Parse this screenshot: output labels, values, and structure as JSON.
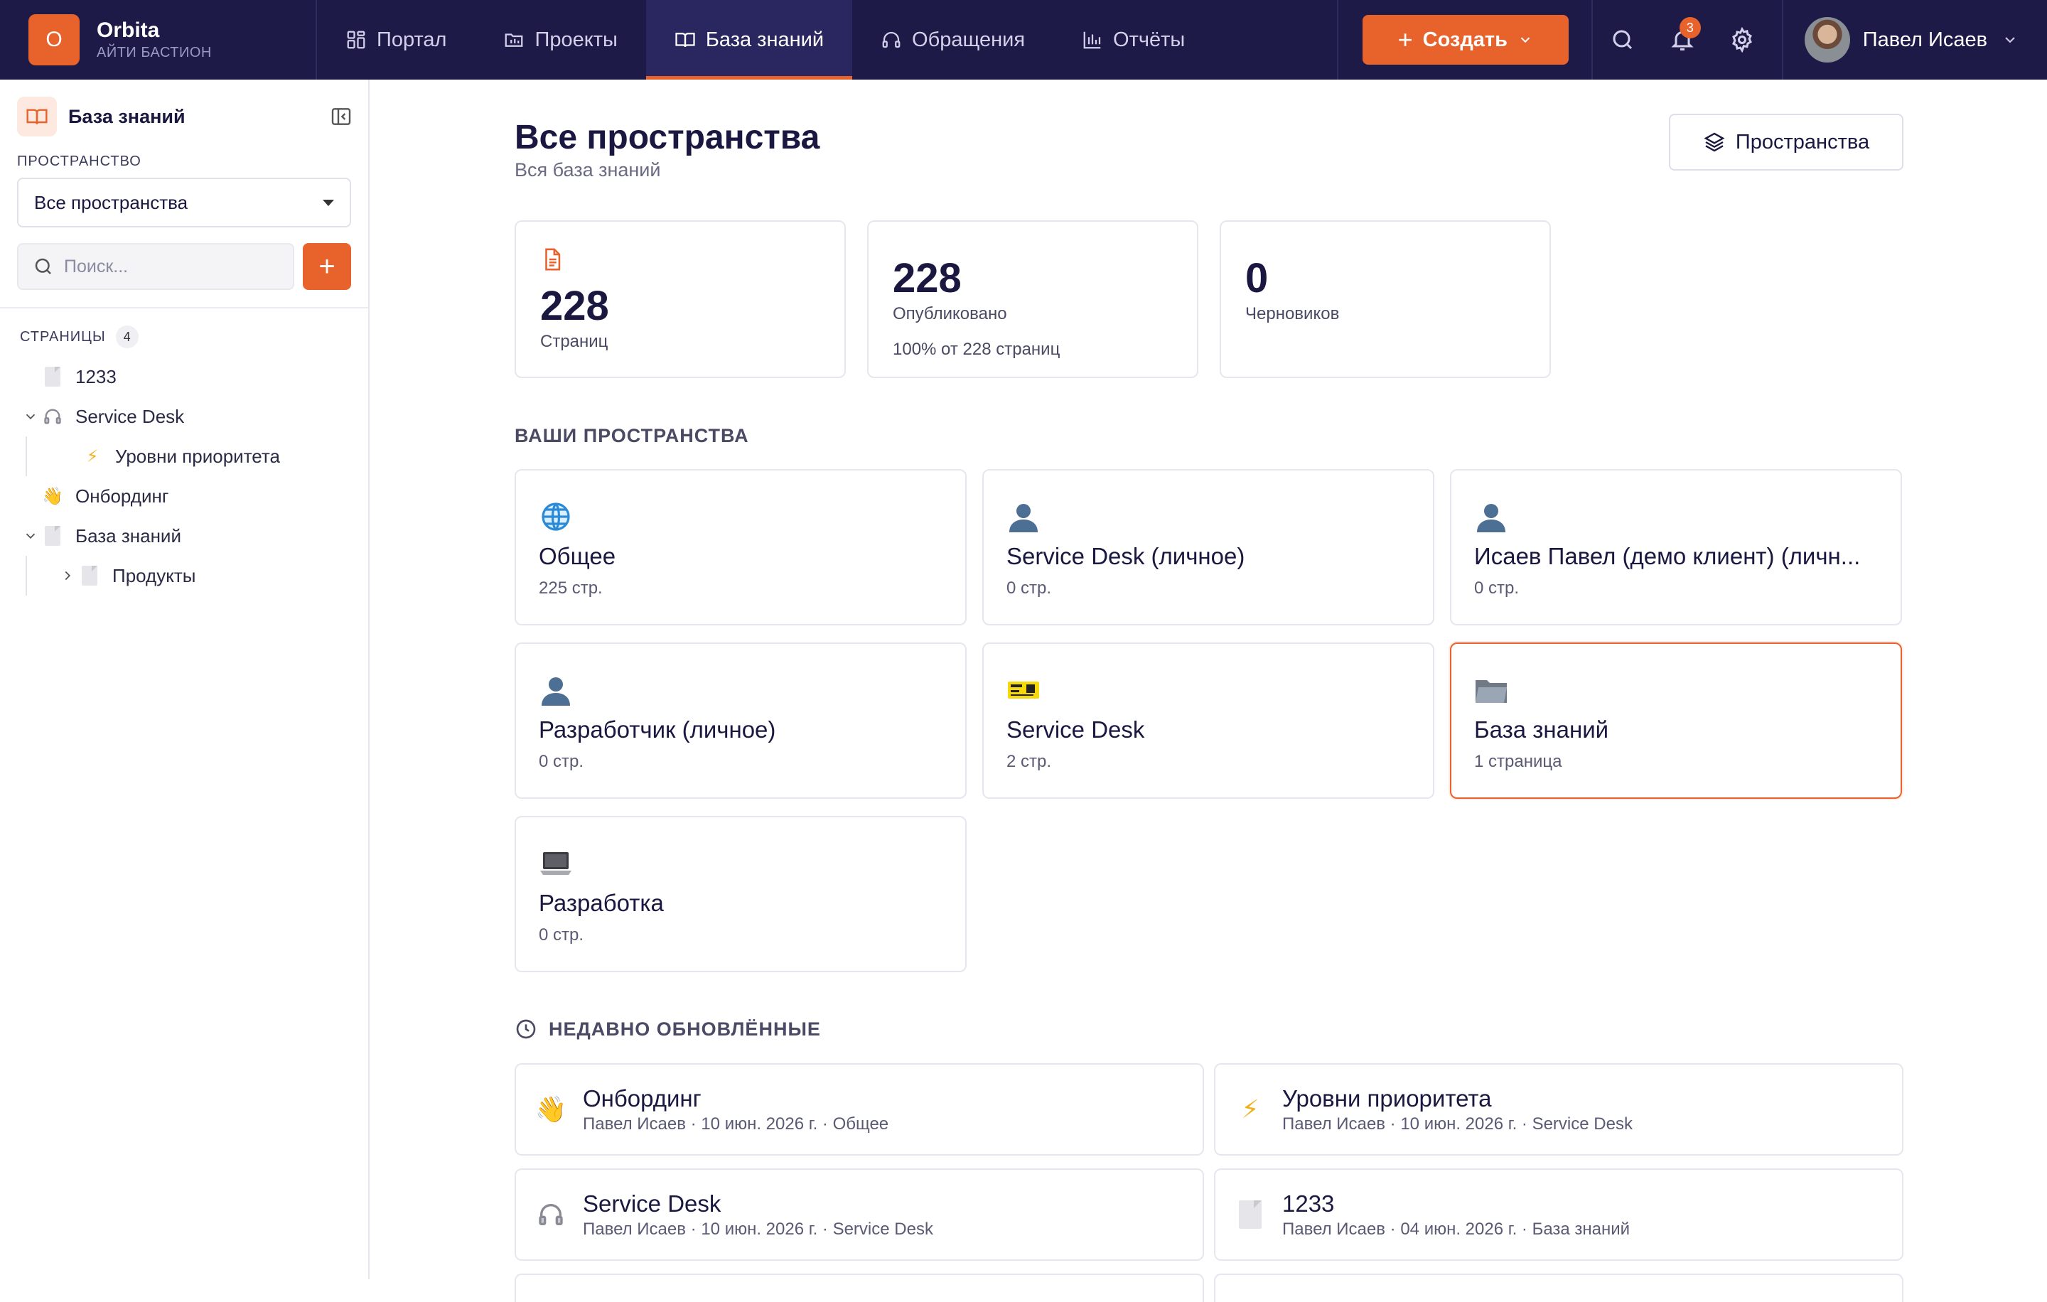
{
  "brand": {
    "logo_letter": "O",
    "name": "Orbita",
    "org": "АЙТИ БАСТИОН"
  },
  "nav": {
    "items": [
      {
        "label": "Портал",
        "icon": "grid-icon"
      },
      {
        "label": "Проекты",
        "icon": "folder-icon"
      },
      {
        "label": "База знаний",
        "icon": "book-icon",
        "active": true
      },
      {
        "label": "Обращения",
        "icon": "headphones-icon"
      },
      {
        "label": "Отчёты",
        "icon": "bar-chart-icon"
      }
    ],
    "create_label": "Создать",
    "notifications_count": "3",
    "user_name": "Павел Исаев"
  },
  "sidebar": {
    "title": "База знаний",
    "space_label": "ПРОСТРАНСТВО",
    "space_selected": "Все пространства",
    "search_placeholder": "Поиск...",
    "pages_label": "СТРАНИЦЫ",
    "pages_count": "4",
    "tree": [
      {
        "label": "1233",
        "icon": "document-icon",
        "level": 0,
        "expanded": null
      },
      {
        "label": "Service Desk",
        "icon": "headphones-emoji-icon",
        "level": 0,
        "expanded": true
      },
      {
        "label": "Уровни приоритета",
        "icon": "lightning-icon",
        "level": 1,
        "expanded": null
      },
      {
        "label": "Онбординг",
        "icon": "waving-hand-icon",
        "level": 0,
        "expanded": null
      },
      {
        "label": "База знаний",
        "icon": "document-icon",
        "level": 0,
        "expanded": true
      },
      {
        "label": "Продукты",
        "icon": "document-icon",
        "level": 1,
        "expanded": false
      }
    ]
  },
  "main": {
    "title": "Все пространства",
    "subtitle": "Вся база знаний",
    "spaces_button": "Пространства",
    "stats": [
      {
        "value": "228",
        "label": "Страниц",
        "note": ""
      },
      {
        "value": "228",
        "label": "Опубликовано",
        "note": "100% от 228 страниц"
      },
      {
        "value": "0",
        "label": "Черновиков",
        "note": ""
      }
    ],
    "your_spaces_title": "ВАШИ ПРОСТРАНСТВА",
    "spaces": [
      {
        "name": "Общее",
        "count": "225 стр.",
        "icon": "globe-icon"
      },
      {
        "name": "Service Desk (личное)",
        "count": "0 стр.",
        "icon": "person-icon"
      },
      {
        "name": "Исаев Павел (демо клиент) (личн...",
        "count": "0 стр.",
        "icon": "person-icon"
      },
      {
        "name": "Разработчик (личное)",
        "count": "0 стр.",
        "icon": "person-icon"
      },
      {
        "name": "Service Desk",
        "count": "2 стр.",
        "icon": "ticket-icon"
      },
      {
        "name": "База знаний",
        "count": "1 страница",
        "icon": "folder-emoji-icon",
        "active": true
      },
      {
        "name": "Разработка",
        "count": "0 стр.",
        "icon": "laptop-icon"
      }
    ],
    "recent_title": "НЕДАВНО ОБНОВЛЁННЫЕ",
    "recent": [
      {
        "title": "Онбординг",
        "meta": "Павел Исаев · 10 июн. 2026 г. · Общее",
        "icon": "waving-hand-icon"
      },
      {
        "title": "Уровни приоритета",
        "meta": "Павел Исаев · 10 июн. 2026 г. · Service Desk",
        "icon": "lightning-icon"
      },
      {
        "title": "Service Desk",
        "meta": "Павел Исаев · 10 июн. 2026 г. · Service Desk",
        "icon": "headphones-emoji-icon"
      },
      {
        "title": "1233",
        "meta": "Павел Исаев · 04 июн. 2026 г. · База знаний",
        "icon": "document-icon"
      }
    ]
  },
  "colors": {
    "accent": "#e8622c",
    "navbar": "#1d1a48",
    "text": "#1a1840"
  }
}
